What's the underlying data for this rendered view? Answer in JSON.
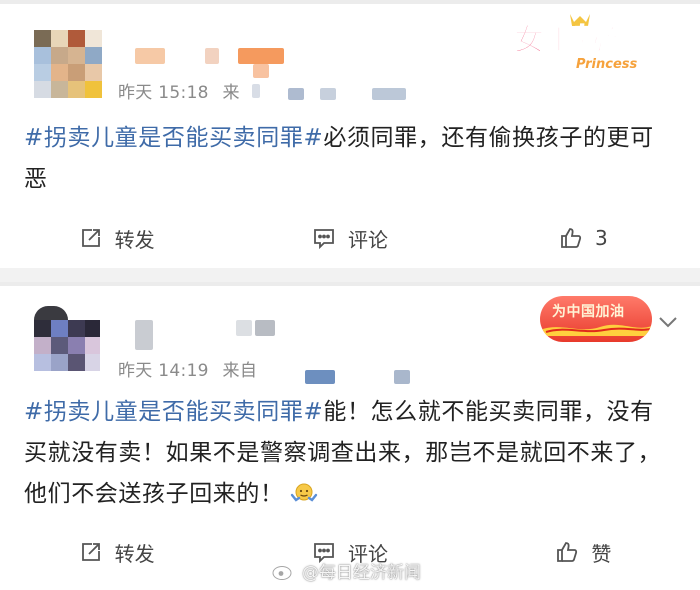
{
  "posts": [
    {
      "time": "昨天 15:18",
      "source_prefix": "来",
      "badge": {
        "line1": "女王驾到",
        "line2": "Princess"
      },
      "topic": "#拐卖儿童是否能买卖同罪#",
      "text": "必须同罪，还有偷换孩子的更可恶",
      "actions": {
        "repost": "转发",
        "comment": "评论",
        "like": "3"
      }
    },
    {
      "time": "昨天 14:19",
      "source_prefix": "来自",
      "badge": {
        "line1": "为中国加油"
      },
      "topic": "#拐卖儿童是否能买卖同罪#",
      "text": "能！怎么就不能买卖同罪，没有买就没有卖！如果不是警察调查出来，那岂不是就回不来了，他们不会送孩子回来的！",
      "actions": {
        "repost": "转发",
        "comment": "评论",
        "like": "赞"
      }
    }
  ],
  "watermark": "@每日经济新闻",
  "icons": {
    "repost": "repost-icon",
    "comment": "comment-icon",
    "like": "thumbs-up-icon",
    "chevron": "chevron-down-icon",
    "emoji": "shrug-emoji-icon",
    "weibo": "weibo-logo-icon"
  },
  "colors": {
    "topic": "#3f6ba8",
    "meta": "#8a8a8a",
    "background": "#f2f2f2"
  }
}
